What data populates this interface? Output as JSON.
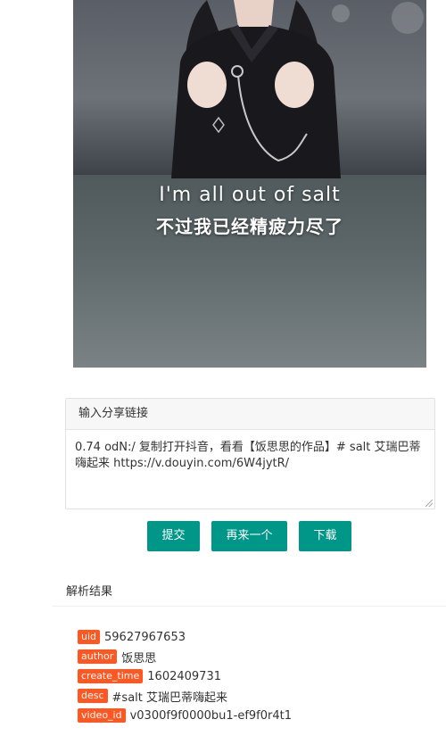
{
  "video": {
    "subtitle_en": "I'm all out of salt",
    "subtitle_zh": "不过我已经精疲力尽了"
  },
  "input_card": {
    "header": "输入分享链接",
    "value": "0.74 odN:/ 复制打开抖音，看看【饭思思的作品】# salt 艾瑞巴蒂嗨起来 https://v.douyin.com/6W4jytR/"
  },
  "buttons": {
    "submit": "提交",
    "again": "再来一个",
    "download": "下载"
  },
  "results": {
    "title": "解析结果",
    "items": [
      {
        "label": "uid",
        "value": "59627967653"
      },
      {
        "label": "author",
        "value": "饭思思"
      },
      {
        "label": "create_time",
        "value": "1602409731"
      },
      {
        "label": "desc",
        "value": "#salt 艾瑞巴蒂嗨起来"
      },
      {
        "label": "video_id",
        "value": "v0300f9f0000bu1-ef9f0r4t1"
      }
    ]
  },
  "colors": {
    "primary_button": "#009688",
    "tag": "#ff5722"
  }
}
